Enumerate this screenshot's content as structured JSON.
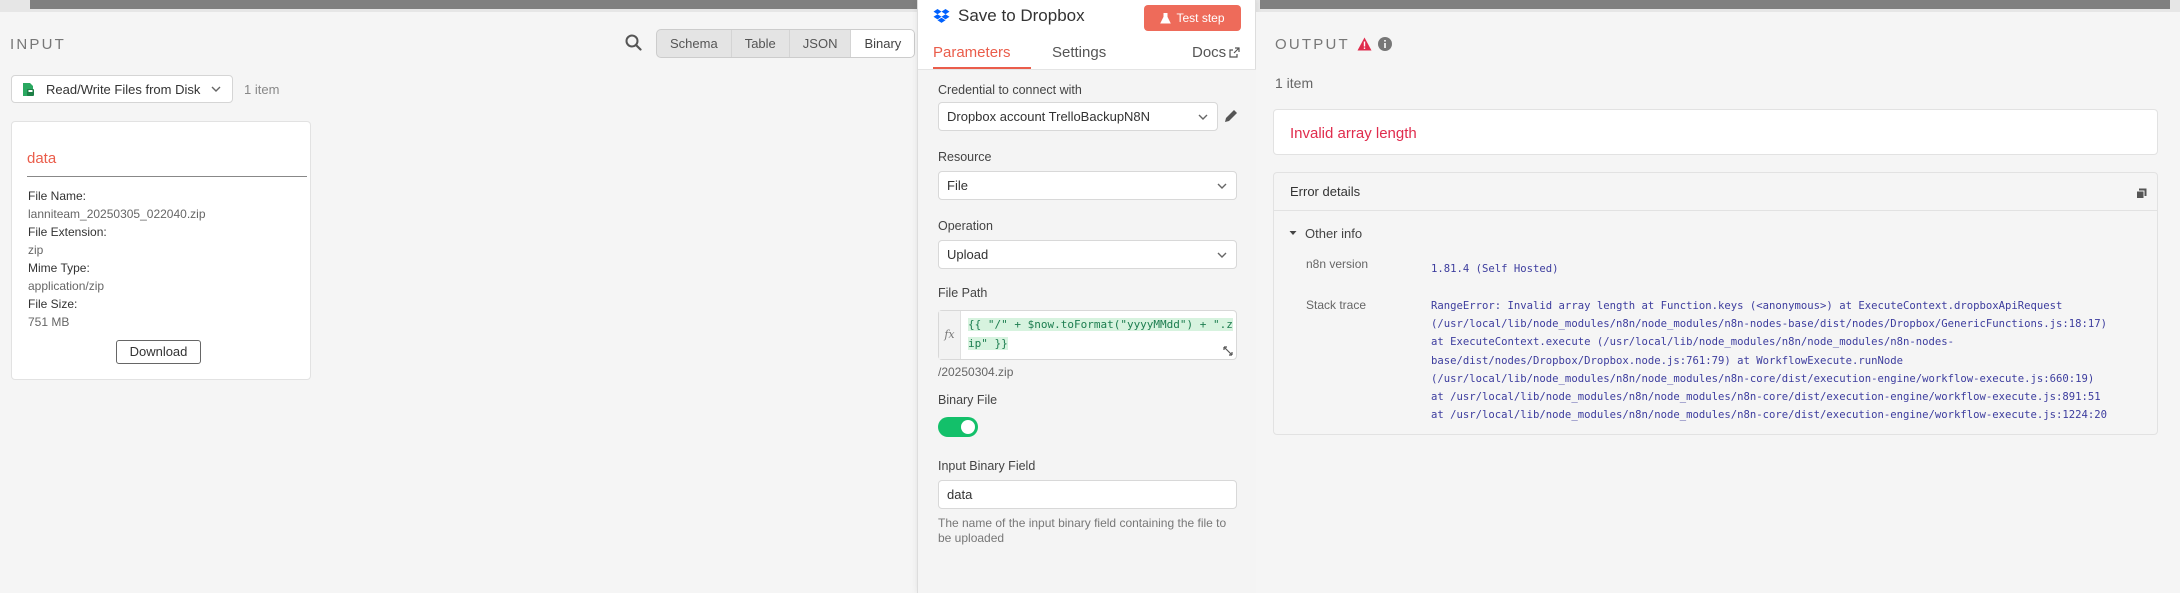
{
  "input_panel": {
    "title": "INPUT",
    "view_tabs": [
      "Schema",
      "Table",
      "JSON",
      "Binary"
    ],
    "active_view": "Binary",
    "node_select": "Read/Write Files from Disk",
    "item_count": "1 item",
    "binary": {
      "title": "data",
      "file_name_label": "File Name:",
      "file_name": "lanniteam_20250305_022040.zip",
      "file_extension_label": "File Extension:",
      "file_extension": "zip",
      "mime_type_label": "Mime Type:",
      "mime_type": "application/zip",
      "file_size_label": "File Size:",
      "file_size": "751 MB",
      "download_label": "Download"
    }
  },
  "node": {
    "title": "Save to Dropbox",
    "test_step_label": "Test step",
    "tabs": [
      "Parameters",
      "Settings"
    ],
    "docs_label": "Docs",
    "credential_label": "Credential to connect with",
    "credential_value": "Dropbox account TrelloBackupN8N",
    "resource_label": "Resource",
    "resource_value": "File",
    "operation_label": "Operation",
    "operation_value": "Upload",
    "file_path_label": "File Path",
    "file_path_expression": "{{ \"/\" + $now.toFormat(\"yyyyMMdd\") + \".zip\" }}",
    "file_path_result": "/20250304.zip",
    "binary_file_label": "Binary File",
    "binary_file_enabled": true,
    "input_binary_field_label": "Input Binary Field",
    "input_binary_field_value": "data",
    "input_binary_field_hint": "The name of the input binary field containing the file to be uploaded"
  },
  "output_panel": {
    "title": "OUTPUT",
    "item_count": "1 item",
    "error_message": "Invalid array length",
    "error_details_label": "Error details",
    "other_info_label": "Other info",
    "n8n_version_label": "n8n version",
    "n8n_version_value": "1.81.4 (Self Hosted)",
    "stack_trace_label": "Stack trace",
    "stack_trace_lines": [
      "RangeError: Invalid array length at Function.keys (<anonymous>) at ExecuteContext.dropboxApiRequest",
      "(/usr/local/lib/node_modules/n8n/node_modules/n8n-nodes-base/dist/nodes/Dropbox/GenericFunctions.js:18:17)",
      "at ExecuteContext.execute (/usr/local/lib/node_modules/n8n/node_modules/n8n-nodes-",
      "base/dist/nodes/Dropbox/Dropbox.node.js:761:79) at WorkflowExecute.runNode",
      "(/usr/local/lib/node_modules/n8n/node_modules/n8n-core/dist/execution-engine/workflow-execute.js:660:19)",
      "at /usr/local/lib/node_modules/n8n/node_modules/n8n-core/dist/execution-engine/workflow-execute.js:891:51",
      "at /usr/local/lib/node_modules/n8n/node_modules/n8n-core/dist/execution-engine/workflow-execute.js:1224:20"
    ]
  },
  "colors": {
    "accent": "#ea5d4b",
    "error": "#e02c4d",
    "toggle_on": "#13c06a",
    "code_green": "#1c7d4f"
  },
  "icons": [
    "search-icon",
    "file-disk-icon",
    "chevron-down-icon",
    "dropbox-icon",
    "flask-icon",
    "external-link-icon",
    "pencil-icon",
    "expand-icon",
    "warning-icon",
    "info-icon",
    "copy-icon",
    "caret-down-icon"
  ]
}
